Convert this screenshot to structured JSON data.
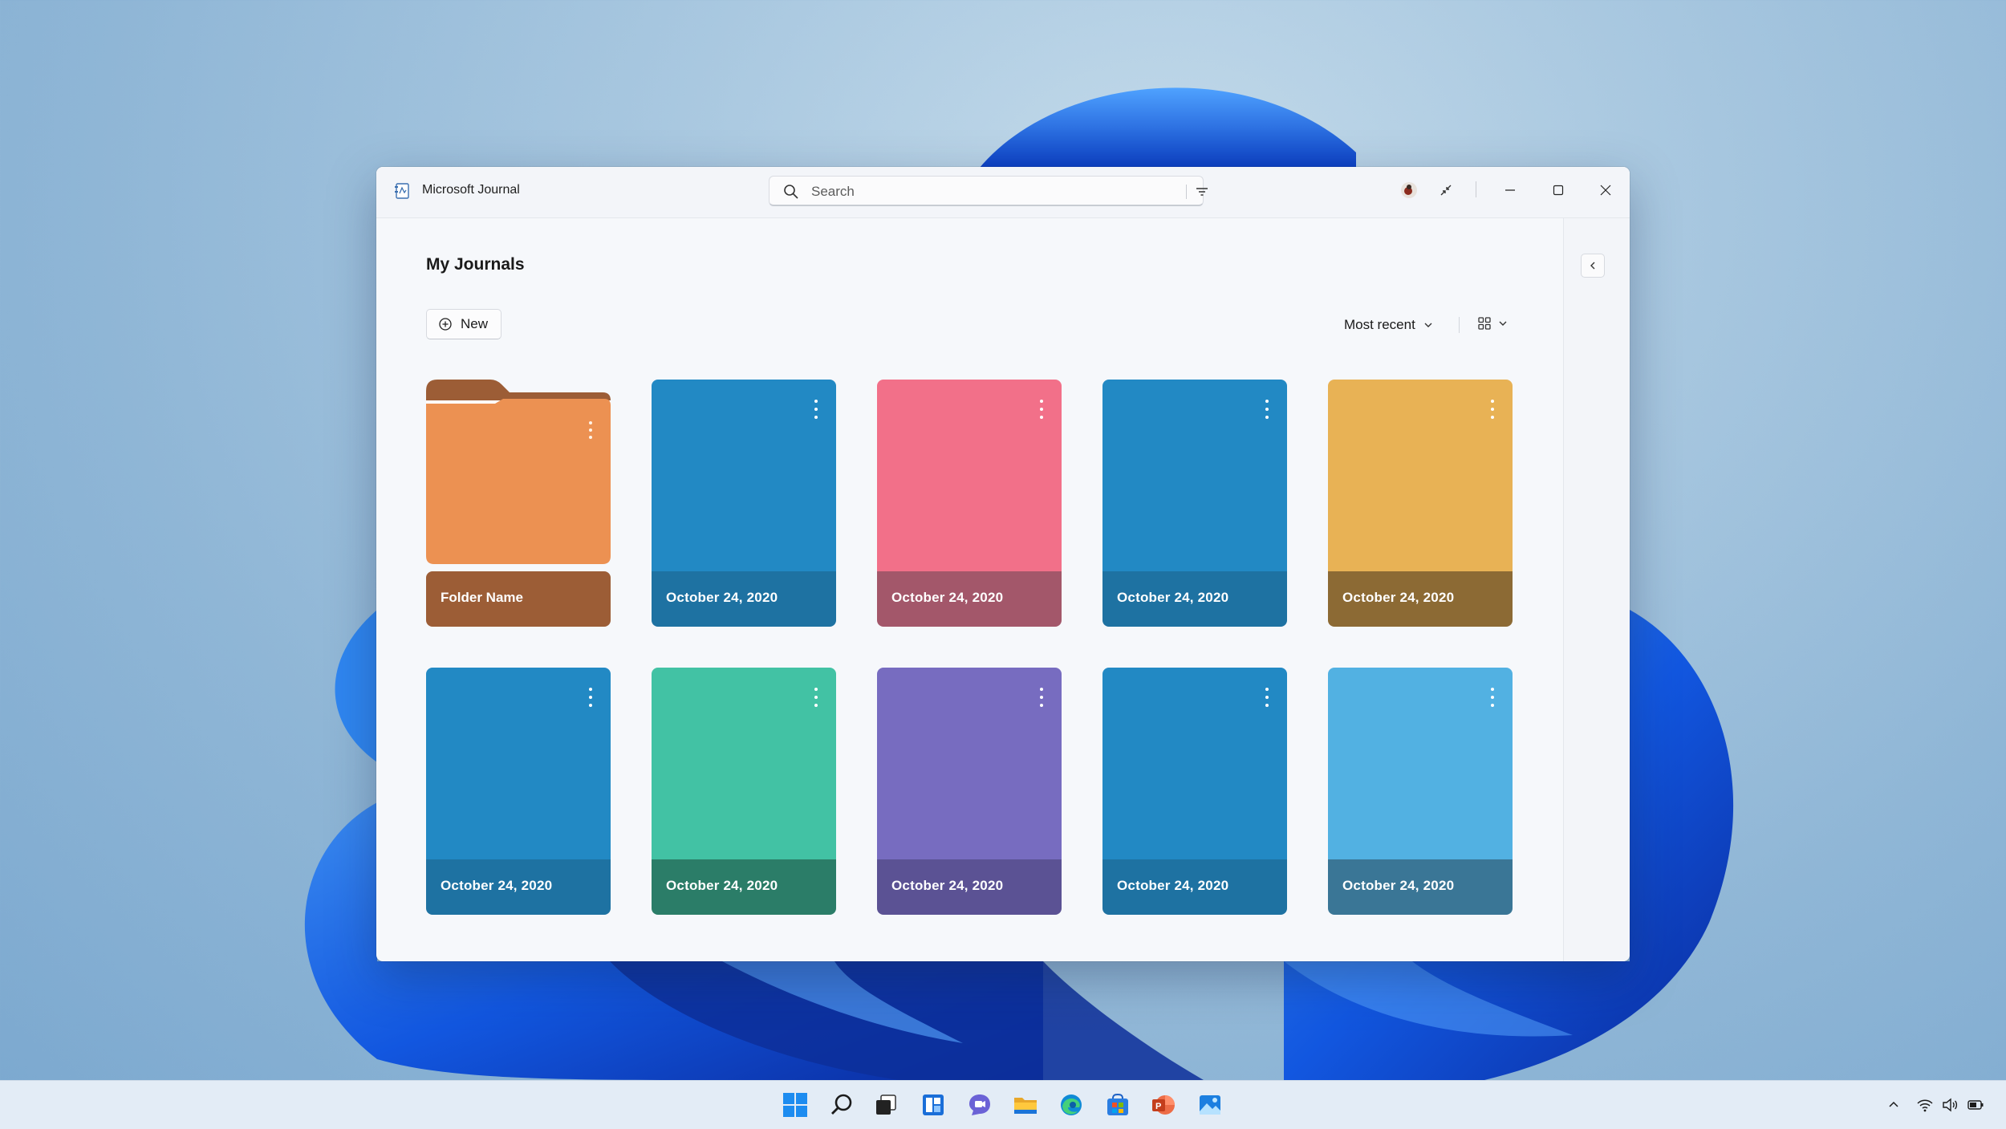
{
  "app": {
    "title": "Microsoft Journal"
  },
  "search": {
    "placeholder": "Search",
    "value": ""
  },
  "page": {
    "title": "My Journals",
    "new_label": "New"
  },
  "sort": {
    "label": "Most recent"
  },
  "folder": {
    "name": "Folder Name",
    "colors": {
      "body": "#ec9152",
      "tab": "#9c5d36",
      "label": "#9c5d36"
    }
  },
  "journals": [
    {
      "date": "October 24, 2020",
      "cover": "#2289c4",
      "footer": "#1e72a2"
    },
    {
      "date": "October 24, 2020",
      "cover": "#f27089",
      "footer": "#a3576a"
    },
    {
      "date": "October 24, 2020",
      "cover": "#2289c4",
      "footer": "#1e72a2"
    },
    {
      "date": "October 24, 2020",
      "cover": "#e8b255",
      "footer": "#8c6a34"
    },
    {
      "date": "October 24, 2020",
      "cover": "#2289c4",
      "footer": "#1e72a2"
    },
    {
      "date": "October 24, 2020",
      "cover": "#42c2a4",
      "footer": "#2b7d68"
    },
    {
      "date": "October 24, 2020",
      "cover": "#776cc0",
      "footer": "#5b5294"
    },
    {
      "date": "October 24, 2020",
      "cover": "#2289c4",
      "footer": "#1e72a2"
    },
    {
      "date": "October 24, 2020",
      "cover": "#52b1e2",
      "footer": "#3a7696"
    }
  ],
  "taskbar": {
    "apps": [
      "start-icon",
      "search-icon",
      "task-view-icon",
      "widgets-icon",
      "teams-chat-icon",
      "file-explorer-icon",
      "edge-icon",
      "store-icon",
      "powerpoint-icon",
      "photos-icon"
    ],
    "tray": [
      "chevron-up-icon",
      "wifi-icon",
      "volume-icon",
      "battery-icon"
    ]
  }
}
